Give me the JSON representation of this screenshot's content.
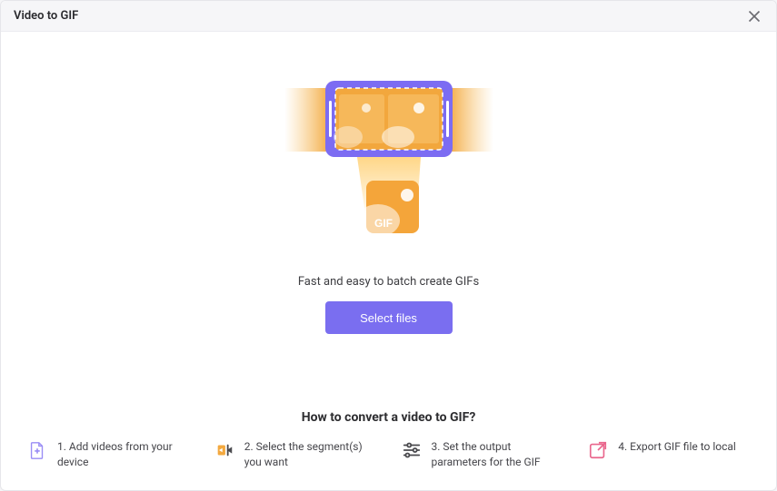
{
  "window": {
    "title": "Video to GIF"
  },
  "hero": {
    "gif_badge": "GIF",
    "tagline": "Fast and easy to batch create GIFs",
    "select_button": "Select files"
  },
  "howto": {
    "title": "How to convert a video to GIF?",
    "steps": [
      {
        "text": "1. Add videos from your device"
      },
      {
        "text": "2. Select the segment(s) you want"
      },
      {
        "text": "3. Set the output parameters for the GIF"
      },
      {
        "text": "4. Export GIF file to local"
      }
    ]
  }
}
